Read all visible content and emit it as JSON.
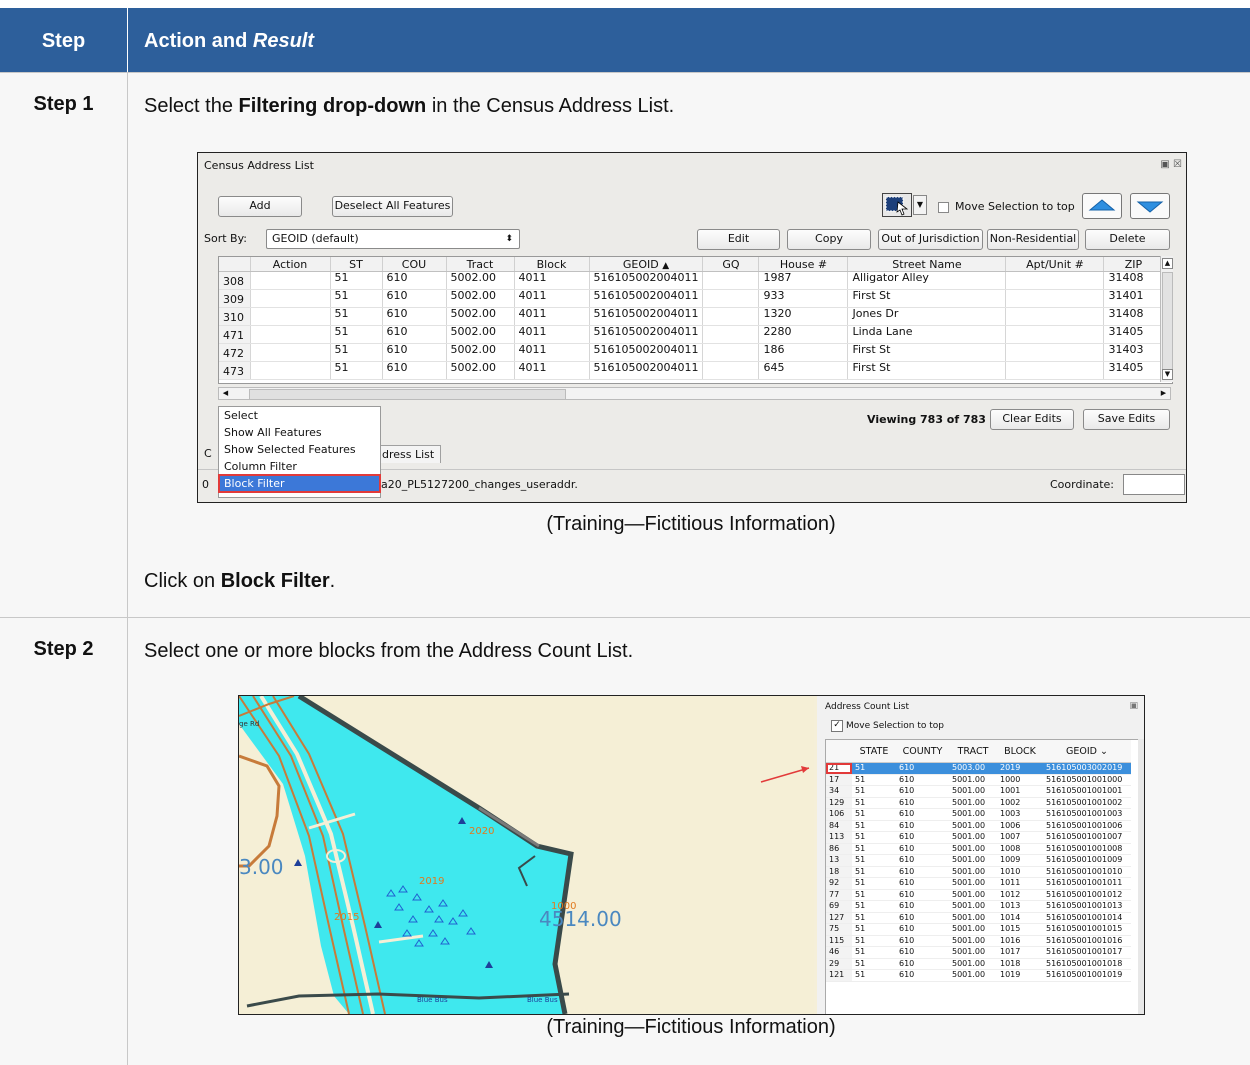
{
  "table_header": {
    "step_col": "Step",
    "action_col_plain": "Action and ",
    "action_col_italic": "Result"
  },
  "step1": {
    "label": "Step 1",
    "instruction_prefix": "Select the ",
    "instruction_bold": "Filtering drop-down",
    "instruction_suffix": " in the Census Address List.",
    "caption": "(Training—Fictitious Information)",
    "click_prefix": "Click on ",
    "click_bold": "Block Filter",
    "click_suffix": ".",
    "screenshot": {
      "window_title": "Census Address List",
      "add_button": "Add",
      "deselect_button": "Deselect All Features",
      "move_selection_label": "Move Selection to top",
      "sort_by_label": "Sort By:",
      "sort_by_value": "GEOID (default)",
      "edit_button": "Edit",
      "copy_button": "Copy",
      "out_of_jurisdiction_button": "Out of Jurisdiction",
      "non_residential_button": "Non-Residential",
      "delete_button": "Delete",
      "columns": [
        "Action",
        "ST",
        "COU",
        "Tract",
        "Block",
        "GEOID",
        "GQ",
        "House #",
        "Street Name",
        "Apt/Unit #",
        "ZIP"
      ],
      "rows": [
        {
          "id": "308",
          "action": "",
          "st": "51",
          "cou": "610",
          "tract": "5002.00",
          "block": "4011",
          "geoid": "516105002004011",
          "gq": "",
          "house": "1987",
          "street": "Alligator Alley",
          "apt": "",
          "zip": "31408"
        },
        {
          "id": "309",
          "action": "",
          "st": "51",
          "cou": "610",
          "tract": "5002.00",
          "block": "4011",
          "geoid": "516105002004011",
          "gq": "",
          "house": "933",
          "street": "First St",
          "apt": "",
          "zip": "31401"
        },
        {
          "id": "310",
          "action": "",
          "st": "51",
          "cou": "610",
          "tract": "5002.00",
          "block": "4011",
          "geoid": "516105002004011",
          "gq": "",
          "house": "1320",
          "street": "Jones Dr",
          "apt": "",
          "zip": "31408"
        },
        {
          "id": "471",
          "action": "",
          "st": "51",
          "cou": "610",
          "tract": "5002.00",
          "block": "4011",
          "geoid": "516105002004011",
          "gq": "",
          "house": "2280",
          "street": "Linda Lane",
          "apt": "",
          "zip": "31405"
        },
        {
          "id": "472",
          "action": "",
          "st": "51",
          "cou": "610",
          "tract": "5002.00",
          "block": "4011",
          "geoid": "516105002004011",
          "gq": "",
          "house": "186",
          "street": "First St",
          "apt": "",
          "zip": "31403"
        },
        {
          "id": "473",
          "action": "",
          "st": "51",
          "cou": "610",
          "tract": "5002.00",
          "block": "4011",
          "geoid": "516105002004011",
          "gq": "",
          "house": "645",
          "street": "First St",
          "apt": "",
          "zip": "31405"
        }
      ],
      "viewing_text": "Viewing 783 of 783",
      "clear_edits_button": "Clear Edits",
      "save_edits_button": "Save Edits",
      "filter_menu": [
        "Select",
        "Show All Features",
        "Show Selected Features",
        "Column Filter",
        "Block Filter"
      ],
      "tab_left": "C",
      "tab_partial": "ddress List",
      "status_left": "0",
      "status_file": "a20_PL5127200_changes_useraddr.",
      "coordinate_label": "Coordinate:"
    }
  },
  "step2": {
    "label": "Step 2",
    "instruction": "Select one or more blocks from the Address Count List.",
    "caption": "(Training—Fictitious Information)",
    "map": {
      "tract_label_left": "3.00",
      "tract_label_right": "4514.00",
      "block_2020": "2020",
      "block_2019": "2019",
      "block_2015": "2015",
      "block_1000": "1000",
      "road_bottom_1": "Blue Bus",
      "road_bottom_2": "Blue Bus",
      "road_left": "ge Rd"
    },
    "address_count_list": {
      "title": "Address Count List",
      "move_selection_label": "Move Selection to top",
      "columns": [
        "STATE",
        "COUNTY",
        "TRACT",
        "BLOCK",
        "GEOID"
      ],
      "rows": [
        {
          "id": "21",
          "state": "51",
          "county": "610",
          "tract": "5003.00",
          "block": "2019",
          "geoid": "516105003002019",
          "selected": true
        },
        {
          "id": "17",
          "state": "51",
          "county": "610",
          "tract": "5001.00",
          "block": "1000",
          "geoid": "516105001001000"
        },
        {
          "id": "34",
          "state": "51",
          "county": "610",
          "tract": "5001.00",
          "block": "1001",
          "geoid": "516105001001001"
        },
        {
          "id": "129",
          "state": "51",
          "county": "610",
          "tract": "5001.00",
          "block": "1002",
          "geoid": "516105001001002"
        },
        {
          "id": "106",
          "state": "51",
          "county": "610",
          "tract": "5001.00",
          "block": "1003",
          "geoid": "516105001001003"
        },
        {
          "id": "84",
          "state": "51",
          "county": "610",
          "tract": "5001.00",
          "block": "1006",
          "geoid": "516105001001006"
        },
        {
          "id": "113",
          "state": "51",
          "county": "610",
          "tract": "5001.00",
          "block": "1007",
          "geoid": "516105001001007"
        },
        {
          "id": "86",
          "state": "51",
          "county": "610",
          "tract": "5001.00",
          "block": "1008",
          "geoid": "516105001001008"
        },
        {
          "id": "13",
          "state": "51",
          "county": "610",
          "tract": "5001.00",
          "block": "1009",
          "geoid": "516105001001009"
        },
        {
          "id": "18",
          "state": "51",
          "county": "610",
          "tract": "5001.00",
          "block": "1010",
          "geoid": "516105001001010"
        },
        {
          "id": "92",
          "state": "51",
          "county": "610",
          "tract": "5001.00",
          "block": "1011",
          "geoid": "516105001001011"
        },
        {
          "id": "77",
          "state": "51",
          "county": "610",
          "tract": "5001.00",
          "block": "1012",
          "geoid": "516105001001012"
        },
        {
          "id": "69",
          "state": "51",
          "county": "610",
          "tract": "5001.00",
          "block": "1013",
          "geoid": "516105001001013"
        },
        {
          "id": "127",
          "state": "51",
          "county": "610",
          "tract": "5001.00",
          "block": "1014",
          "geoid": "516105001001014"
        },
        {
          "id": "75",
          "state": "51",
          "county": "610",
          "tract": "5001.00",
          "block": "1015",
          "geoid": "516105001001015"
        },
        {
          "id": "115",
          "state": "51",
          "county": "610",
          "tract": "5001.00",
          "block": "1016",
          "geoid": "516105001001016"
        },
        {
          "id": "46",
          "state": "51",
          "county": "610",
          "tract": "5001.00",
          "block": "1017",
          "geoid": "516105001001017"
        },
        {
          "id": "29",
          "state": "51",
          "county": "610",
          "tract": "5001.00",
          "block": "1018",
          "geoid": "516105001001018"
        },
        {
          "id": "121",
          "state": "51",
          "county": "610",
          "tract": "5001.00",
          "block": "1019",
          "geoid": "516105001001019"
        }
      ]
    }
  },
  "colors": {
    "header_bg": "#2d5f9b",
    "block_fill": "#3fe8ee",
    "selection_blue": "#3c8fdc",
    "highlight_red": "#e23a3a"
  }
}
